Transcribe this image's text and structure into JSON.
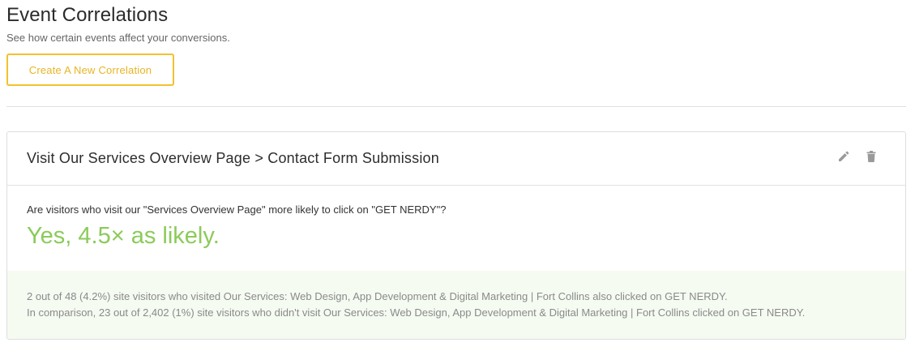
{
  "header": {
    "title": "Event Correlations",
    "subtitle": "See how certain events affect your conversions.",
    "create_button_label": "Create A New Correlation"
  },
  "correlation": {
    "title": "Visit Our Services Overview Page > Contact Form Submission",
    "question": "Are visitors who visit our \"Services Overview Page\" more likely to click on \"GET NERDY\"?",
    "answer": "Yes, 4.5× as likely.",
    "detail_line_1": "2 out of 48 (4.2%) site visitors who visited Our Services: Web Design, App Development & Digital Marketing | Fort Collins also clicked on GET NERDY.",
    "detail_line_2": "In comparison, 23 out of 2,402 (1%) site visitors who didn't visit Our Services: Web Design, App Development & Digital Marketing | Fort Collins clicked on GET NERDY.",
    "actions": {
      "edit_icon": "pencil-icon",
      "delete_icon": "trash-icon"
    }
  },
  "colors": {
    "accent": "#f2c12e",
    "positive": "#8bcb5a",
    "details_background": "#f5fbf1"
  }
}
